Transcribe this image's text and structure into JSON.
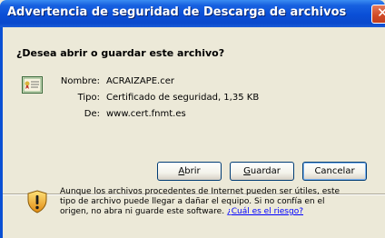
{
  "window": {
    "title": "Advertencia de seguridad de Descarga de archivos",
    "close_glyph": "✕"
  },
  "dialog": {
    "question": "¿Desea abrir o guardar este archivo?",
    "fields": [
      {
        "label": "Nombre:",
        "value": "ACRAIZAPE.cer"
      },
      {
        "label": "Tipo:",
        "value": "Certificado de seguridad, 1,35 KB"
      },
      {
        "label": "De:",
        "value": "www.cert.fnmt.es"
      }
    ],
    "buttons": {
      "open": {
        "acc": "A",
        "rest": "brir"
      },
      "save": {
        "acc": "G",
        "rest": "uardar"
      },
      "cancel": {
        "label": "Cancelar"
      }
    },
    "warning": {
      "line1": "Aunque los archivos procedentes de Internet pueden ser útiles, este",
      "line2": "tipo de archivo puede llegar a dañar el equipo. Si no confía en el",
      "line3_prefix": "origen, no abra ni guarde este software. ",
      "link": "¿Cuál es el riesgo?"
    }
  },
  "icons": {
    "file": "certificate-file-icon",
    "warning": "security-shield-icon"
  },
  "colors": {
    "titlebar": "#0a4fd6",
    "dialog_bg": "#ece9d8",
    "link": "#0000ff"
  }
}
